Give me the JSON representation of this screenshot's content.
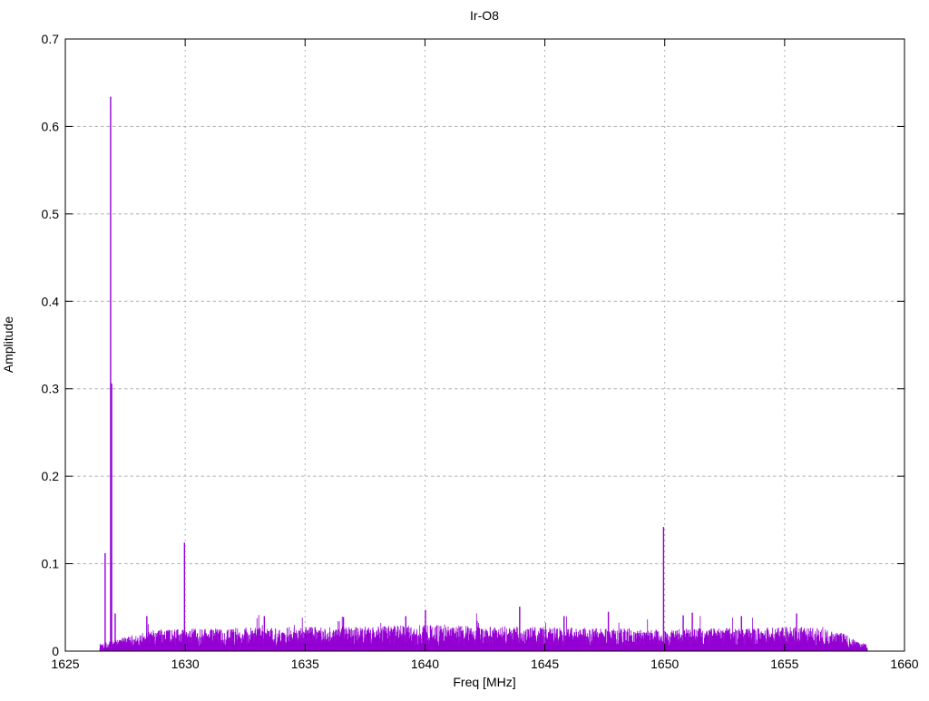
{
  "page": {
    "background": "#ffffff"
  },
  "chart_data": {
    "type": "line",
    "subtype": "impulse-spectrum",
    "title": "Ir-O8",
    "xlabel": "Freq [MHz]",
    "ylabel": "Amplitude",
    "xlim": [
      1625,
      1660
    ],
    "ylim": [
      0,
      0.7
    ],
    "xticks": [
      1625,
      1630,
      1635,
      1640,
      1645,
      1650,
      1655,
      1660
    ],
    "xtick_labels": [
      "1625",
      "1630",
      "1635",
      "1640",
      "1645",
      "1650",
      "1655",
      "1660"
    ],
    "yticks": [
      0,
      0.1,
      0.2,
      0.3,
      0.4,
      0.5,
      0.6,
      0.7
    ],
    "ytick_labels": [
      "0",
      "0.1",
      "0.2",
      "0.3",
      "0.4",
      "0.5",
      "0.6",
      "0.7"
    ],
    "grid": true,
    "legend_position": "none",
    "line_color": "#9400d3",
    "grid_color": "#b0b0b0",
    "border_color": "#000000",
    "text_color": "#000000",
    "data_start_mhz": 1626.44,
    "data_end_mhz": 1658.45,
    "peaks": [
      {
        "freq": 1626.66,
        "amp": 0.112
      },
      {
        "freq": 1626.89,
        "amp": 0.634
      },
      {
        "freq": 1626.93,
        "amp": 0.306
      },
      {
        "freq": 1627.08,
        "amp": 0.043
      },
      {
        "freq": 1629.97,
        "amp": 0.124
      },
      {
        "freq": 1649.95,
        "amp": 0.142
      },
      {
        "freq": 1640.02,
        "amp": 0.047
      },
      {
        "freq": 1643.95,
        "amp": 0.051
      },
      {
        "freq": 1647.65,
        "amp": 0.045
      },
      {
        "freq": 1650.77,
        "amp": 0.041
      },
      {
        "freq": 1651.15,
        "amp": 0.044
      },
      {
        "freq": 1655.5,
        "amp": 0.043
      },
      {
        "freq": 1628.4,
        "amp": 0.04
      },
      {
        "freq": 1633.3,
        "amp": 0.04
      },
      {
        "freq": 1636.6,
        "amp": 0.039
      },
      {
        "freq": 1639.2,
        "amp": 0.04
      },
      {
        "freq": 1645.8,
        "amp": 0.04
      },
      {
        "freq": 1653.2,
        "amp": 0.04
      }
    ],
    "noise_floor": {
      "samples": 3000,
      "seed": 1337,
      "band_min_frac": 0.18,
      "spike_chance": 0.015,
      "spike_gain": 1.55,
      "envelope": [
        [
          1626.44,
          0.01
        ],
        [
          1627.2,
          0.014
        ],
        [
          1628.0,
          0.02
        ],
        [
          1629.0,
          0.025
        ],
        [
          1632.0,
          0.027
        ],
        [
          1636.0,
          0.028
        ],
        [
          1640.0,
          0.03
        ],
        [
          1644.0,
          0.028
        ],
        [
          1648.0,
          0.026
        ],
        [
          1652.0,
          0.026
        ],
        [
          1656.0,
          0.028
        ],
        [
          1657.3,
          0.022
        ],
        [
          1658.0,
          0.013
        ],
        [
          1658.45,
          0.007
        ]
      ]
    }
  }
}
